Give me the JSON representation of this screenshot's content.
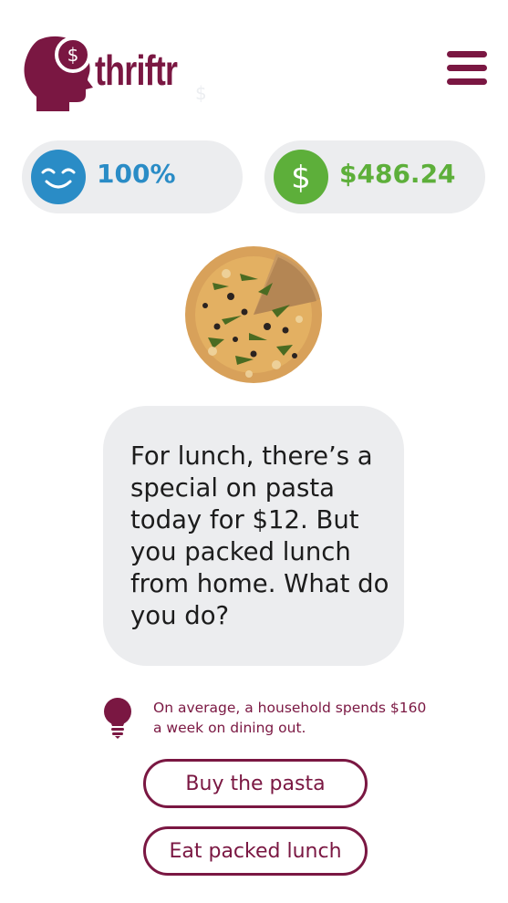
{
  "header": {
    "app_name": "thriftr",
    "logo_symbol": "$",
    "ghost_symbol": "$",
    "menu_icon": "hamburger-menu-icon"
  },
  "stats": {
    "happiness": {
      "value": "100%",
      "icon": "smiley-face-icon",
      "color": "#2a8cc6"
    },
    "balance": {
      "value": "$486.24",
      "icon_symbol": "$",
      "icon": "dollar-icon",
      "color": "#5daf3a"
    }
  },
  "scenario": {
    "image": "pizza-image",
    "message": "For lunch, there’s a special on pasta today for $12. But you packed lunch from home. What do you do?"
  },
  "tip": {
    "icon": "lightbulb-icon",
    "text": "On average, a household spends $160 a week on dining out."
  },
  "choices": [
    {
      "label": "Buy the pasta"
    },
    {
      "label": "Eat packed lunch"
    }
  ],
  "colors": {
    "brand": "#7a1742",
    "pill_bg": "#ecedef",
    "happy_blue": "#2a8cc6",
    "money_green": "#5daf3a"
  }
}
